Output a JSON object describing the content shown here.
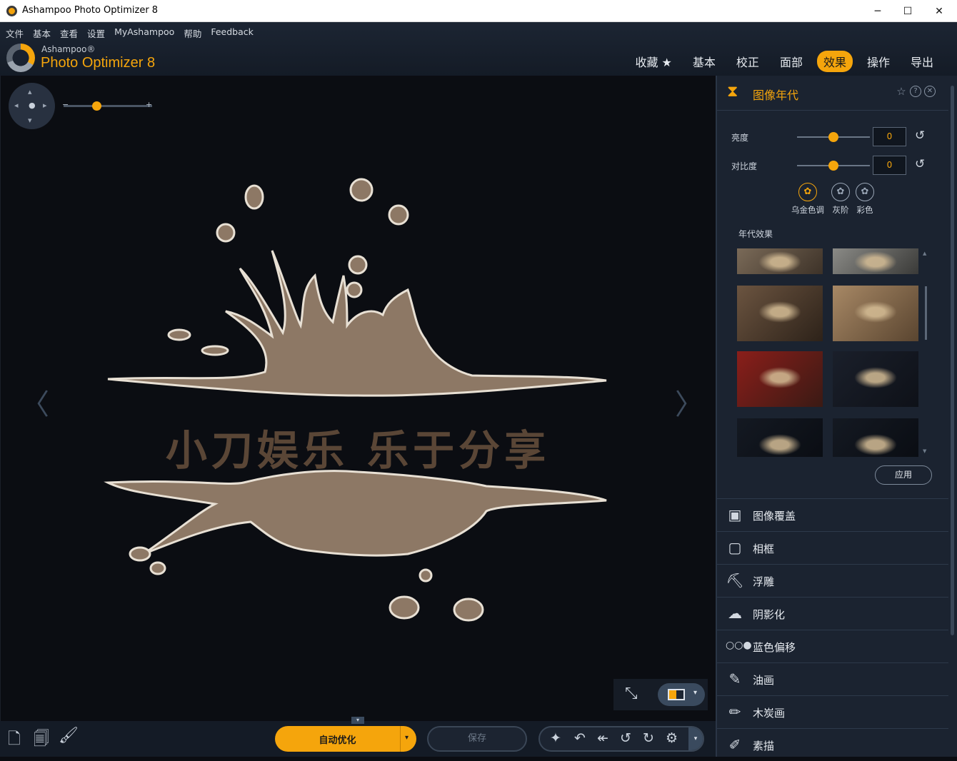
{
  "window": {
    "title": "Ashampoo Photo Optimizer 8",
    "controls": [
      "─",
      "☐",
      "✕"
    ]
  },
  "menu": [
    "文件",
    "基本",
    "查看",
    "设置",
    "MyAshampoo",
    "帮助",
    "Feedback"
  ],
  "logo": {
    "small": "Ashampoo®",
    "big": "Photo Optimizer 8"
  },
  "tabs": [
    {
      "label": "收藏 ★",
      "active": false
    },
    {
      "label": "基本",
      "active": false
    },
    {
      "label": "校正",
      "active": false
    },
    {
      "label": "面部",
      "active": false
    },
    {
      "label": "效果",
      "active": true
    },
    {
      "label": "操作",
      "active": false
    },
    {
      "label": "导出",
      "active": false
    }
  ],
  "canvas": {
    "zoom_minus": "−",
    "zoom_plus": "+",
    "prev_arrow": "〈",
    "next_arrow": "〉",
    "image_text": "小刀娱乐 乐于分享"
  },
  "bottombar": {
    "auto_optimize": "自动优化",
    "save": "保存"
  },
  "panel": {
    "title": "图像年代",
    "brightness": {
      "label": "亮度",
      "value": "0"
    },
    "contrast": {
      "label": "对比度",
      "value": "0"
    },
    "tones": [
      {
        "label": "乌金色调",
        "active": true
      },
      {
        "label": "灰阶",
        "active": false
      },
      {
        "label": "彩色",
        "active": false
      }
    ],
    "era_effects_label": "年代效果",
    "apply": "应用",
    "effects": [
      {
        "label": "图像覆盖",
        "icon": "image-overlay-icon"
      },
      {
        "label": "相框",
        "icon": "frame-icon"
      },
      {
        "label": "浮雕",
        "icon": "emboss-icon"
      },
      {
        "label": "阴影化",
        "icon": "shadow-icon"
      },
      {
        "label": "蓝色偏移",
        "icon": "blue-shift-icon"
      },
      {
        "label": "油画",
        "icon": "oil-paint-icon"
      },
      {
        "label": "木炭画",
        "icon": "charcoal-icon"
      },
      {
        "label": "素描",
        "icon": "sketch-icon"
      }
    ]
  },
  "colors": {
    "accent": "#f5a50c",
    "panel_bg": "#1b2330",
    "canvas_bg": "#0b0d12"
  }
}
